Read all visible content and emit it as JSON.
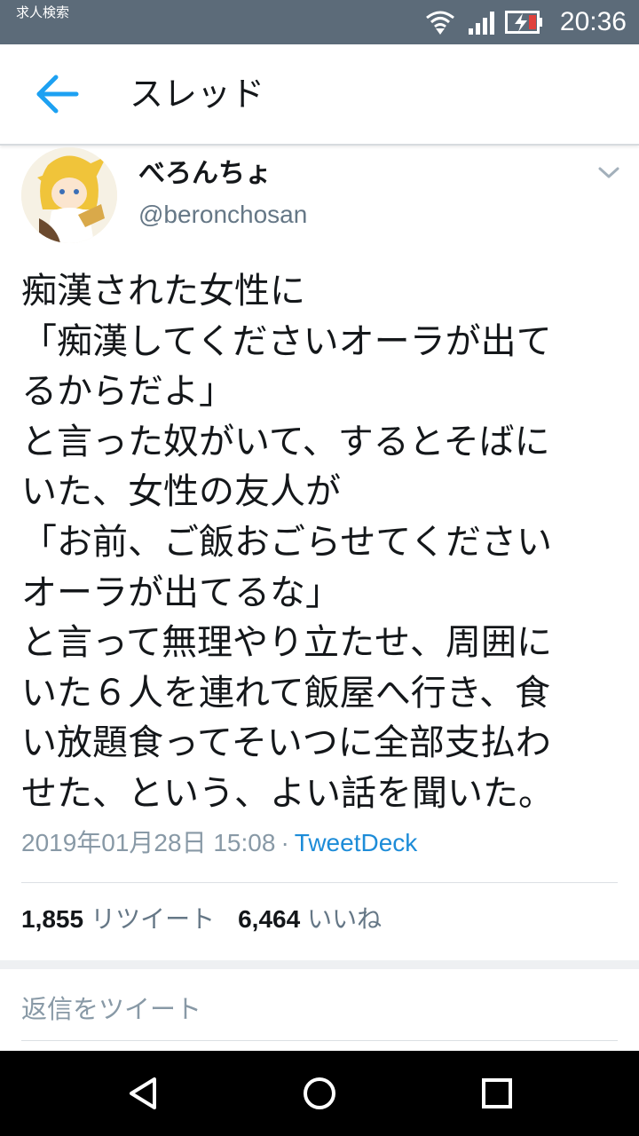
{
  "status_bar": {
    "notification_text": "求人検索",
    "time": "20:36",
    "icons": [
      "wifi-icon",
      "signal-icon",
      "battery-icon"
    ]
  },
  "header": {
    "title": "スレッド",
    "back_icon": "arrow-left-icon"
  },
  "tweet": {
    "display_name": "べろんちょ",
    "handle": "@beronchosan",
    "body_lines": [
      "痴漢された女性に",
      "「痴漢してくださいオーラが出て",
      "るからだよ」",
      "と言った奴がいて、するとそばに",
      "いた、女性の友人が",
      "「お前、ご飯おごらせてください",
      "オーラが出てるな」",
      "と言って無理やり立たせ、周囲に",
      "いた６人を連れて飯屋へ行き、食",
      "い放題食ってそいつに全部支払わ",
      "せた、という、よい話を聞いた。"
    ],
    "timestamp": "2019年01月28日 15:08",
    "separator": "·",
    "client": "TweetDeck",
    "retweet_count": "1,855",
    "retweet_label": "リツイート",
    "like_count": "6,464",
    "like_label": "いいね"
  },
  "reply": {
    "placeholder": "返信をツイート"
  },
  "colors": {
    "status_bar": "#5c6b79",
    "accent": "#1d8cd8",
    "secondary_text": "#657786"
  }
}
